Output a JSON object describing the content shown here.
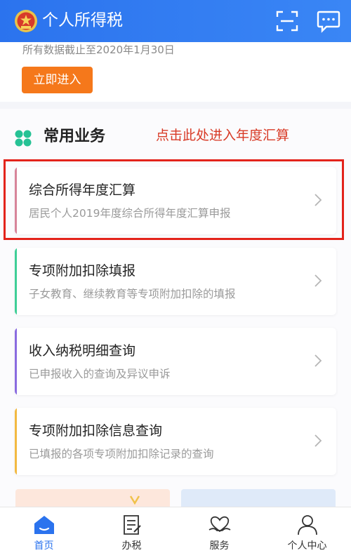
{
  "header": {
    "title": "个人所得税"
  },
  "notice": {
    "text": "所有数据截止至2020年1月30日",
    "button": "立即进入"
  },
  "section": {
    "title": "常用业务",
    "hint": "点击此处进入年度汇算"
  },
  "cards": [
    {
      "title": "综合所得年度汇算",
      "subtitle": "居民个人2019年度综合所得年度汇算申报",
      "accent": "#d7849a"
    },
    {
      "title": "专项附加扣除填报",
      "subtitle": "子女教育、继续教育等专项附加扣除的填报",
      "accent": "#3fcf97"
    },
    {
      "title": "收入纳税明细查询",
      "subtitle": "已申报收入的查询及异议申诉",
      "accent": "#8a6be0"
    },
    {
      "title": "专项附加扣除信息查询",
      "subtitle": "已填报的各项专项附加扣除记录的查询",
      "accent": "#f2b941"
    }
  ],
  "tabs": [
    {
      "label": "首页",
      "active": true
    },
    {
      "label": "办税",
      "active": false
    },
    {
      "label": "服务",
      "active": false
    },
    {
      "label": "个人中心",
      "active": false
    }
  ],
  "colors": {
    "primary": "#2b73ee",
    "button": "#f5781b",
    "highlight": "#e3231b"
  }
}
